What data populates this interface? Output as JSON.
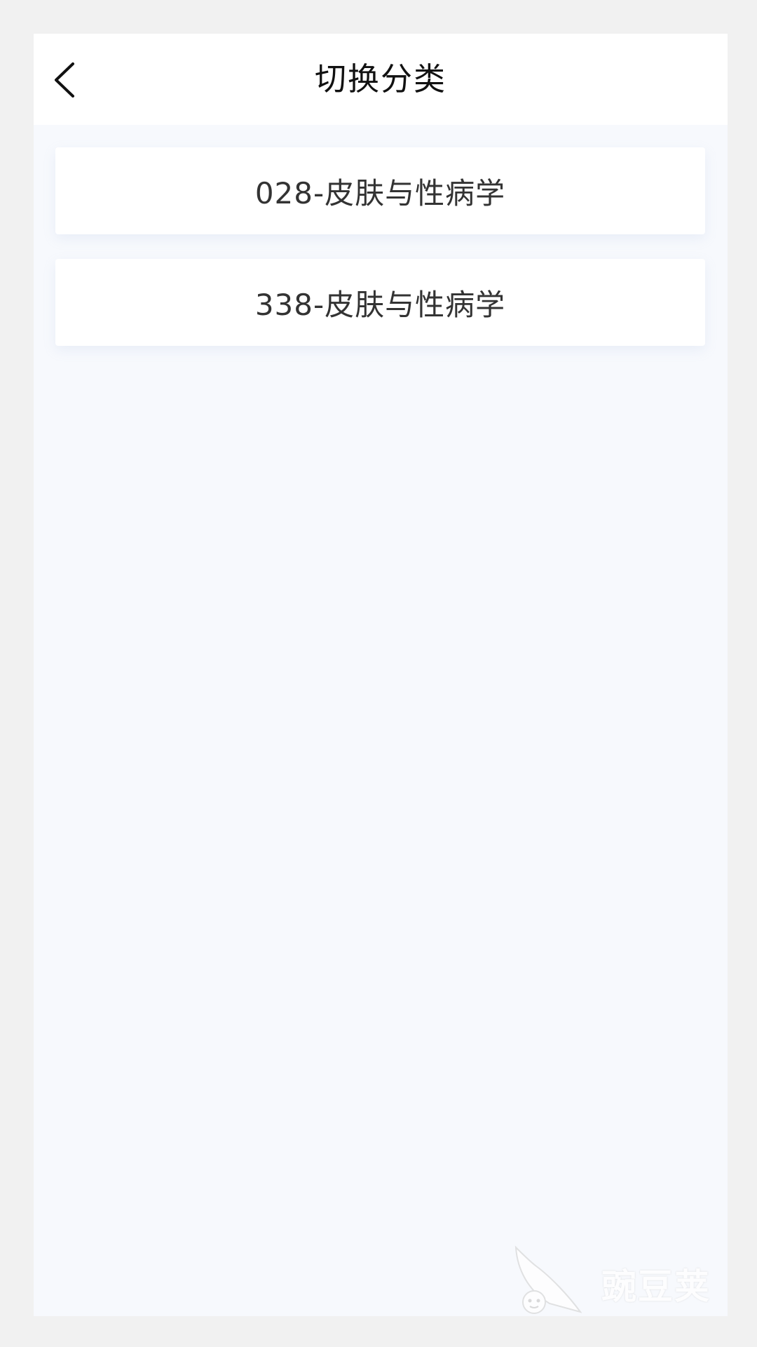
{
  "header": {
    "title": "切换分类",
    "back_icon": "chevron-left-icon"
  },
  "categories": [
    {
      "label": "028-皮肤与性病学"
    },
    {
      "label": "338-皮肤与性病学"
    }
  ],
  "watermark": {
    "text": "豌豆荚",
    "icon": "pea-pod-logo-icon"
  },
  "colors": {
    "page_background": "#f7f9fd",
    "header_background": "#ffffff",
    "card_background": "#ffffff",
    "title_text": "#111111",
    "item_text": "#333333"
  }
}
